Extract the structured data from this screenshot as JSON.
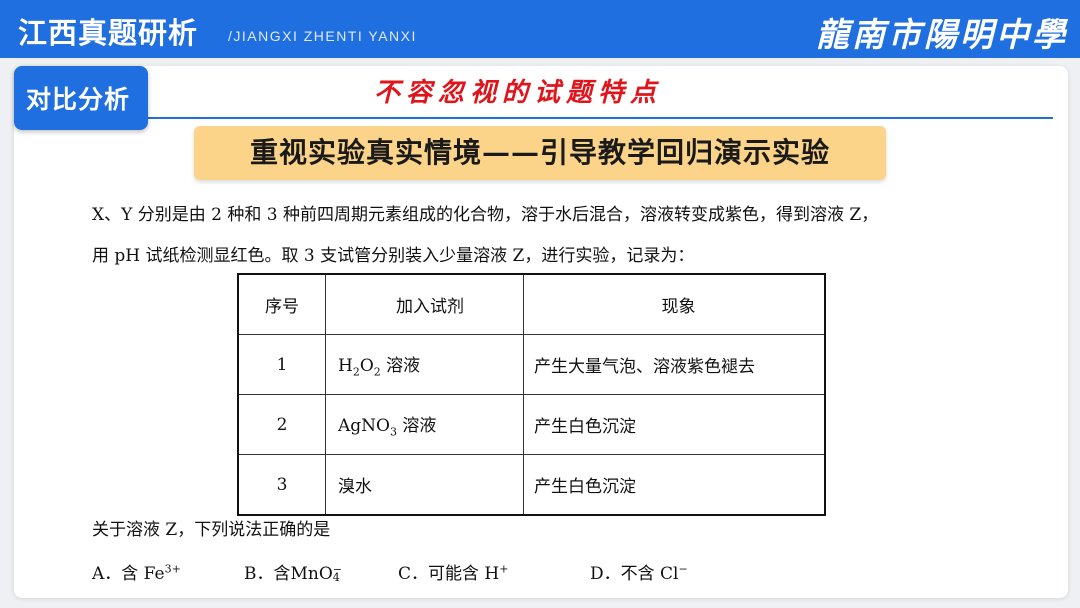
{
  "header": {
    "title": "江西真题研析",
    "subtitle": "/JIANGXI ZHENTI YANXI",
    "school": "龍南市陽明中學"
  },
  "tag": {
    "label": "对比分析"
  },
  "feature_title": "不容忽视的试题特点",
  "banner": "重视实验真实情境——引导教学回归演示实验",
  "question": {
    "line1": "X、Y 分别是由 2 种和 3 种前四周期元素组成的化合物，溶于水后混合，溶液转变成紫色，得到溶液 Z，",
    "line2": "用 pH 试纸检测显红色。取 3 支试管分别装入少量溶液 Z，进行实验，记录为：",
    "prompt": "关于溶液 Z，下列说法正确的是"
  },
  "table": {
    "headers": [
      "序号",
      "加入试剂",
      "现象"
    ],
    "rows": [
      {
        "no": "1",
        "reagent_parts": [
          "H",
          "2",
          "O",
          "2",
          " 溶液"
        ],
        "phenomenon": "产生大量气泡、溶液紫色褪去"
      },
      {
        "no": "2",
        "reagent_parts": [
          "AgNO",
          "3",
          " 溶液"
        ],
        "phenomenon": "产生白色沉淀"
      },
      {
        "no": "3",
        "reagent": "溴水",
        "phenomenon": "产生白色沉淀"
      }
    ]
  },
  "options": {
    "a": {
      "prefix": "A．含 Fe",
      "sup": "3+"
    },
    "b": {
      "prefix": "B．含MnO",
      "sup": "−",
      "sub": "4"
    },
    "c": {
      "prefix": "C．可能含 H",
      "sup": "+"
    },
    "d": {
      "prefix": "D．不含 Cl",
      "sup": "−"
    }
  },
  "colors": {
    "brand_blue": "#1f6fe0",
    "title_red": "#e0141b",
    "banner_bg": "#fbd389"
  }
}
